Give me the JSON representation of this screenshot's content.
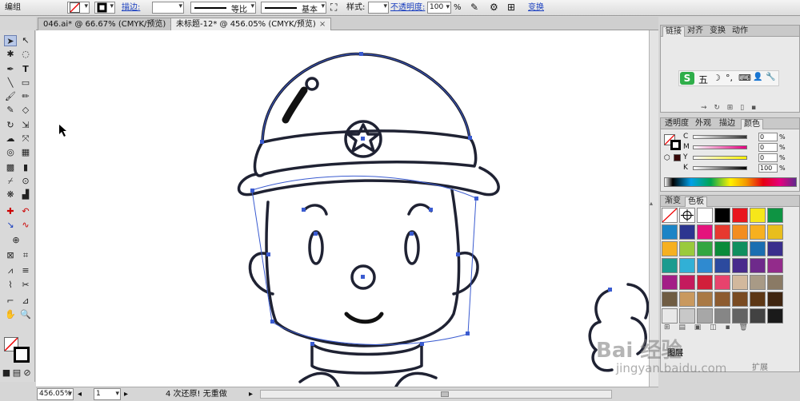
{
  "control_bar": {
    "mode_label": "编组",
    "stroke_label": "描边:",
    "profile_label": "等比",
    "brush_label": "基本",
    "style_label": "样式:",
    "opacity_label": "不透明度:",
    "opacity_value": "100",
    "opacity_unit": "%",
    "transform_label": "变换"
  },
  "tabs": [
    {
      "label": "046.ai* @ 66.67% (CMYK/预览)",
      "close": "×"
    },
    {
      "label": "未标题-12* @ 456.05% (CMYK/预览)",
      "close": "×"
    }
  ],
  "status_bar": {
    "zoom": "456.05%",
    "artboard": "1",
    "status_text": "4 次还原! 无重做"
  },
  "panels": {
    "top_tabs": [
      "链接",
      "对齐",
      "变换",
      "动作"
    ],
    "ime_icons": [
      "五",
      "☽",
      "°,",
      "⌨",
      "👤",
      "🔧"
    ],
    "ime_logo": "S",
    "color_tabs": [
      "透明度",
      "外观",
      "描边",
      "颜色"
    ],
    "color_sliders": [
      {
        "label": "C",
        "value": "0"
      },
      {
        "label": "M",
        "value": "0"
      },
      {
        "label": "Y",
        "value": "0"
      },
      {
        "label": "K",
        "value": "100"
      }
    ],
    "swatch_tabs": [
      "渐变",
      "色板"
    ],
    "layers_label": "图层",
    "expand_label": "扩展"
  },
  "swatch_colors": [
    [
      "#ffffff",
      "#ffffff",
      "#ffffff",
      "#000000",
      "#e8161e",
      "#f6e71a",
      "#0e9443"
    ],
    [
      "#1b84c6",
      "#2c3690",
      "#e4137c",
      "#e7392f",
      "#f38d21",
      "#f7b01f",
      "#e8be1d"
    ],
    [
      "#f6b021",
      "#9aca3c",
      "#33a641",
      "#0b8b3a",
      "#108f5f",
      "#1b6eb1",
      "#3a2e8c"
    ],
    [
      "#1b9b8f",
      "#31b0d6",
      "#2f8ad0",
      "#2c4a9e",
      "#482a8c",
      "#6e2a8b",
      "#932b8b"
    ],
    [
      "#a31d86",
      "#c41a5d",
      "#d11f3a",
      "#e7436d",
      "#d2b89d",
      "#a89a86",
      "#8a7a65"
    ],
    [
      "#6f5c43",
      "#c9995f",
      "#a97945",
      "#8d5b2f",
      "#7a4b22",
      "#5d3715",
      "#3f2510"
    ],
    [
      "#e8e8e8",
      "#c8c8c8",
      "#a7a7a7",
      "#868686",
      "#646464",
      "#424242",
      "#1a1a1a"
    ]
  ],
  "watermark": {
    "text": "Bai 经验",
    "sub": "jingyan.baidu.com"
  },
  "icons": [
    "selection-icon",
    "direct-selection-icon",
    "magic-wand-icon",
    "lasso-icon",
    "pen-icon",
    "type-icon",
    "line-icon",
    "rectangle-icon",
    "paintbrush-icon",
    "pencil-icon",
    "blob-brush-icon",
    "eraser-icon",
    "rotate-icon",
    "scale-icon",
    "warp-icon",
    "free-transform-icon",
    "shape-builder-icon",
    "perspective-icon",
    "mesh-icon",
    "gradient-icon",
    "eyedropper-icon",
    "blend-icon",
    "symbol-sprayer-icon",
    "graph-icon",
    "artboard-icon",
    "slice-icon",
    "hand-icon",
    "zoom-icon"
  ]
}
